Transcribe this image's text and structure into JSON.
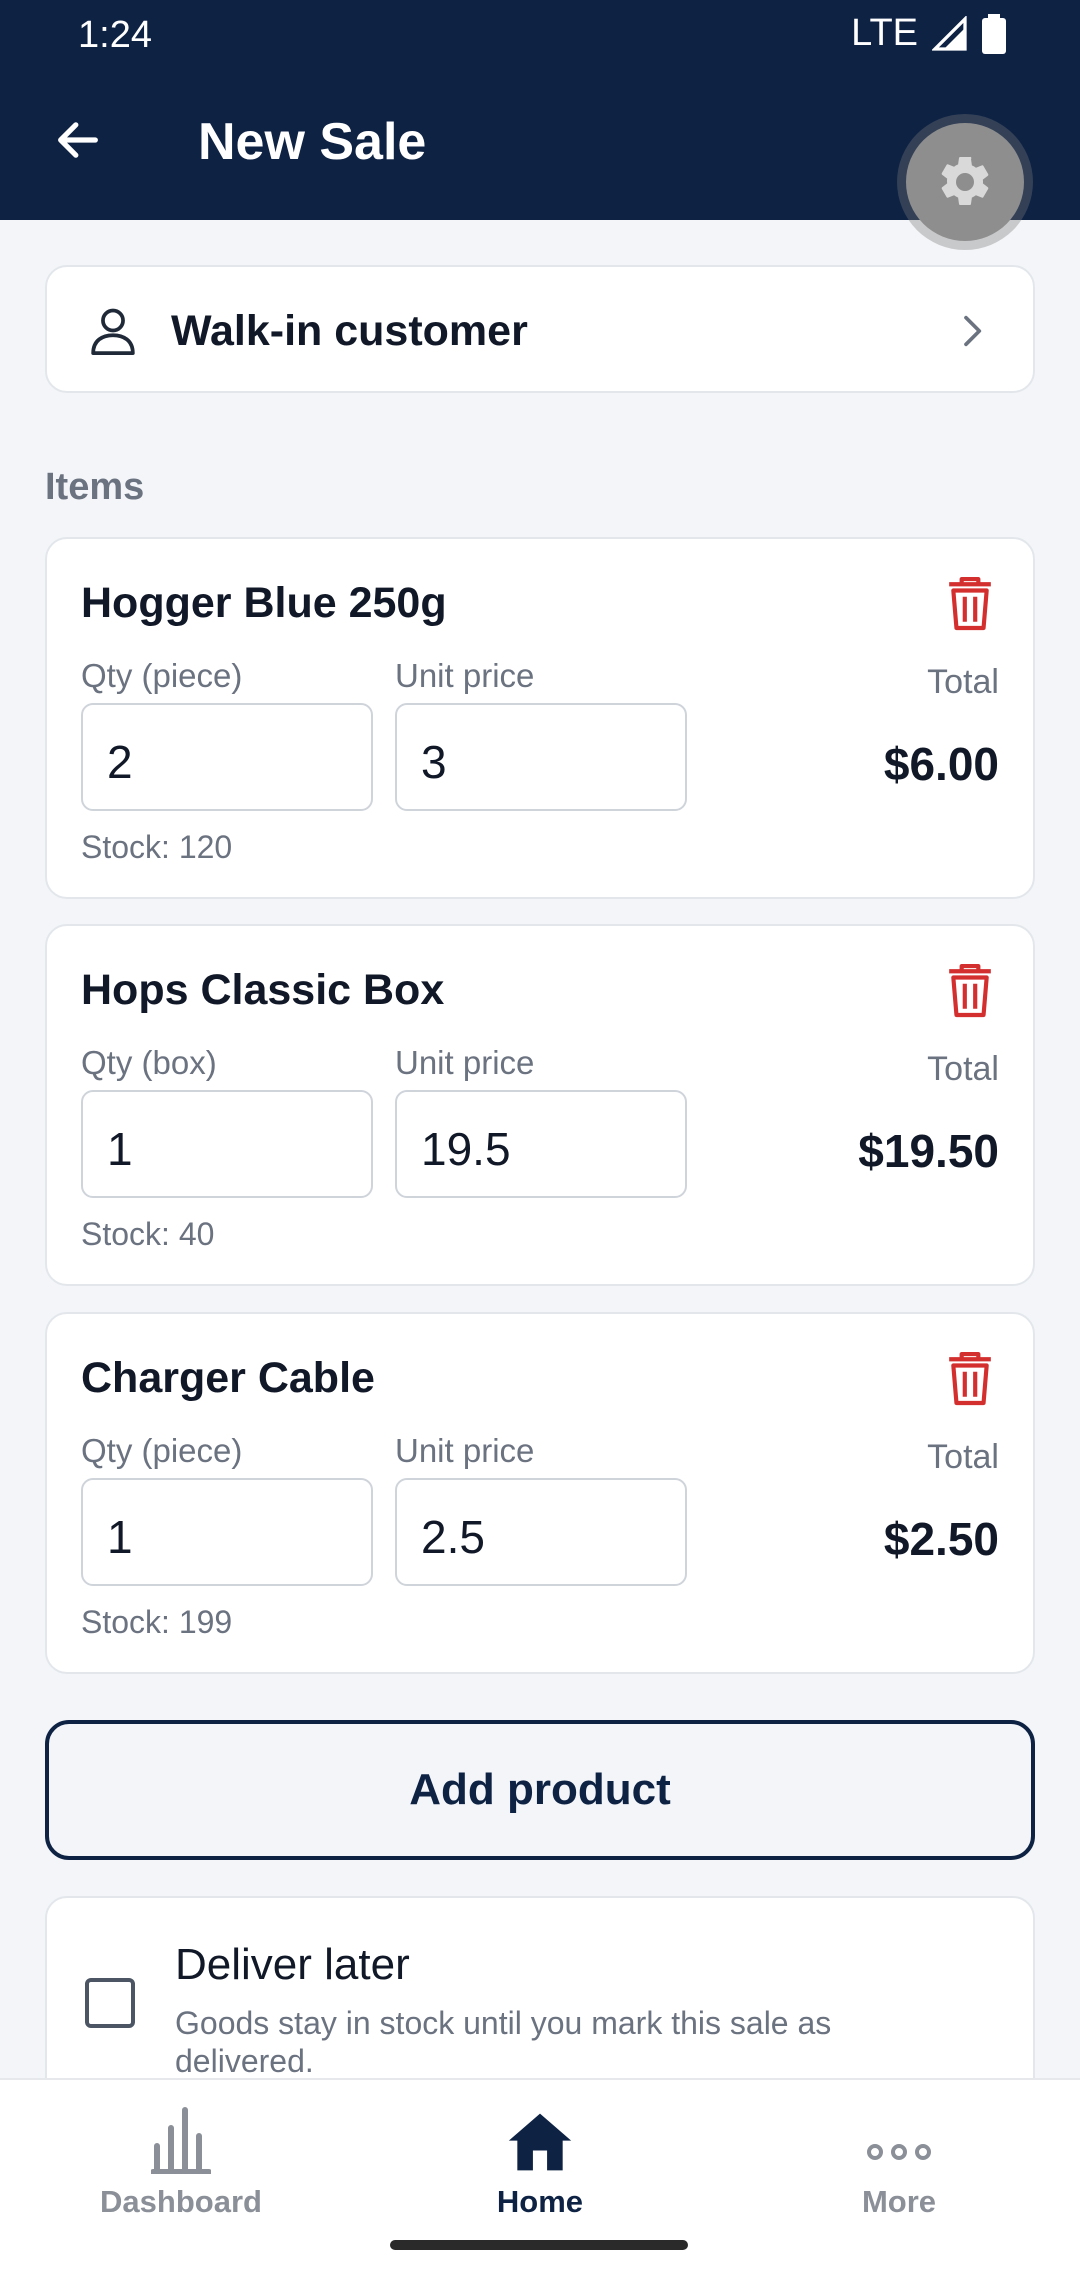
{
  "status_bar": {
    "time": "1:24",
    "network": "LTE"
  },
  "app_bar": {
    "title": "New Sale"
  },
  "customer": {
    "label": "Walk-in customer"
  },
  "items_section": {
    "label": "Items"
  },
  "items": [
    {
      "name": "Hogger Blue 250g",
      "qty_label": "Qty (piece)",
      "qty": "2",
      "price_label": "Unit price",
      "price": "3",
      "total_label": "Total",
      "total": "$6.00",
      "stock": "Stock: 120"
    },
    {
      "name": "Hops Classic Box",
      "qty_label": "Qty (box)",
      "qty": "1",
      "price_label": "Unit price",
      "price": "19.5",
      "total_label": "Total",
      "total": "$19.50",
      "stock": "Stock: 40"
    },
    {
      "name": "Charger Cable",
      "qty_label": "Qty (piece)",
      "qty": "1",
      "price_label": "Unit price",
      "price": "2.5",
      "total_label": "Total",
      "total": "$2.50",
      "stock": "Stock: 199"
    }
  ],
  "add_product": {
    "label": "Add product"
  },
  "deliver_later": {
    "title": "Deliver later",
    "description": "Goods stay in stock until you mark this sale as delivered.",
    "checked": false
  },
  "bottom_nav": {
    "items": [
      {
        "label": "Dashboard",
        "icon": "bar-chart-icon",
        "active": false
      },
      {
        "label": "Home",
        "icon": "home-icon",
        "active": true
      },
      {
        "label": "More",
        "icon": "more-horizontal-icon",
        "active": false
      }
    ]
  },
  "colors": {
    "primary": "#0e2244",
    "danger": "#d32f2f",
    "muted": "#6b7280",
    "background": "#f3f5f8"
  }
}
